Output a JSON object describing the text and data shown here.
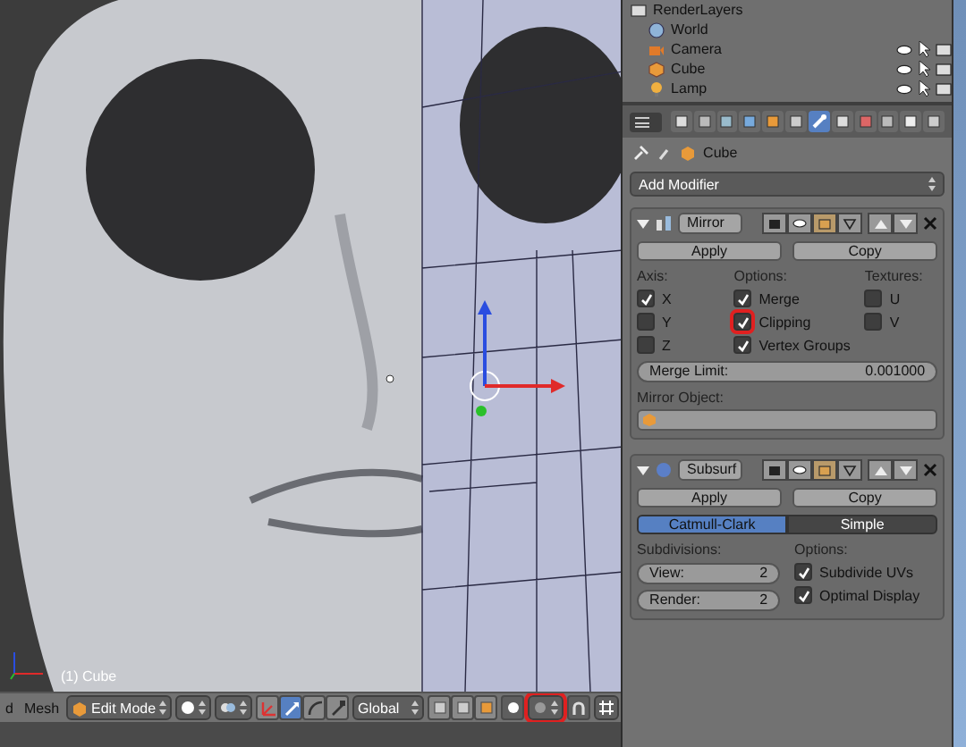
{
  "viewport": {
    "object_label": "(1) Cube"
  },
  "header": {
    "menus": [
      "d",
      "Mesh"
    ],
    "mode": "Edit Mode",
    "orientation": "Global",
    "proportional": {
      "highlighted": true
    },
    "manipulators": [
      {
        "kind": "toggle",
        "selected": false
      },
      {
        "kind": "translate",
        "selected": true
      },
      {
        "kind": "rotate",
        "selected": false
      },
      {
        "kind": "scale",
        "selected": false
      }
    ]
  },
  "outliner": {
    "items": [
      {
        "name": "RenderLayers",
        "kind": "renderlayers"
      },
      {
        "name": "World",
        "kind": "world"
      },
      {
        "name": "Camera",
        "kind": "camera"
      },
      {
        "name": "Cube",
        "kind": "mesh"
      },
      {
        "name": "Lamp",
        "kind": "lamp"
      }
    ]
  },
  "properties": {
    "tabs": [
      {
        "kind": "render",
        "selected": false
      },
      {
        "kind": "layers",
        "selected": false
      },
      {
        "kind": "scene",
        "selected": false
      },
      {
        "kind": "world",
        "selected": false
      },
      {
        "kind": "object",
        "selected": false
      },
      {
        "kind": "constraints",
        "selected": false
      },
      {
        "kind": "modifiers",
        "selected": true
      },
      {
        "kind": "data",
        "selected": false
      },
      {
        "kind": "material",
        "selected": false
      },
      {
        "kind": "texture",
        "selected": false
      },
      {
        "kind": "particles",
        "selected": false
      },
      {
        "kind": "physics",
        "selected": false
      }
    ],
    "breadcrumb": "Cube",
    "add_modifier": "Add Modifier",
    "mirror": {
      "name": "Mirror",
      "apply": "Apply",
      "copy": "Copy",
      "axis_label": "Axis:",
      "options_label": "Options:",
      "textures_label": "Textures:",
      "axes": [
        {
          "label": "X",
          "checked": true
        },
        {
          "label": "Y",
          "checked": false
        },
        {
          "label": "Z",
          "checked": false
        }
      ],
      "options": [
        {
          "label": "Merge",
          "checked": true
        },
        {
          "label": "Clipping",
          "checked": true,
          "highlighted": true
        },
        {
          "label": "Vertex Groups",
          "checked": true
        }
      ],
      "textures": [
        {
          "label": "U",
          "checked": false
        },
        {
          "label": "V",
          "checked": false
        }
      ],
      "merge_limit_label": "Merge Limit:",
      "merge_limit": "0.001000",
      "mirror_object_label": "Mirror Object:"
    },
    "subsurf": {
      "name": "Subsurf",
      "apply": "Apply",
      "copy": "Copy",
      "types": [
        {
          "label": "Catmull-Clark",
          "selected": true
        },
        {
          "label": "Simple",
          "selected": false
        }
      ],
      "subdivisions_label": "Subdivisions:",
      "view_label": "View:",
      "view": "2",
      "render_label": "Render:",
      "render": "2",
      "options_label": "Options:",
      "options": [
        {
          "label": "Subdivide UVs",
          "checked": true
        },
        {
          "label": "Optimal Display",
          "checked": true
        }
      ]
    }
  }
}
